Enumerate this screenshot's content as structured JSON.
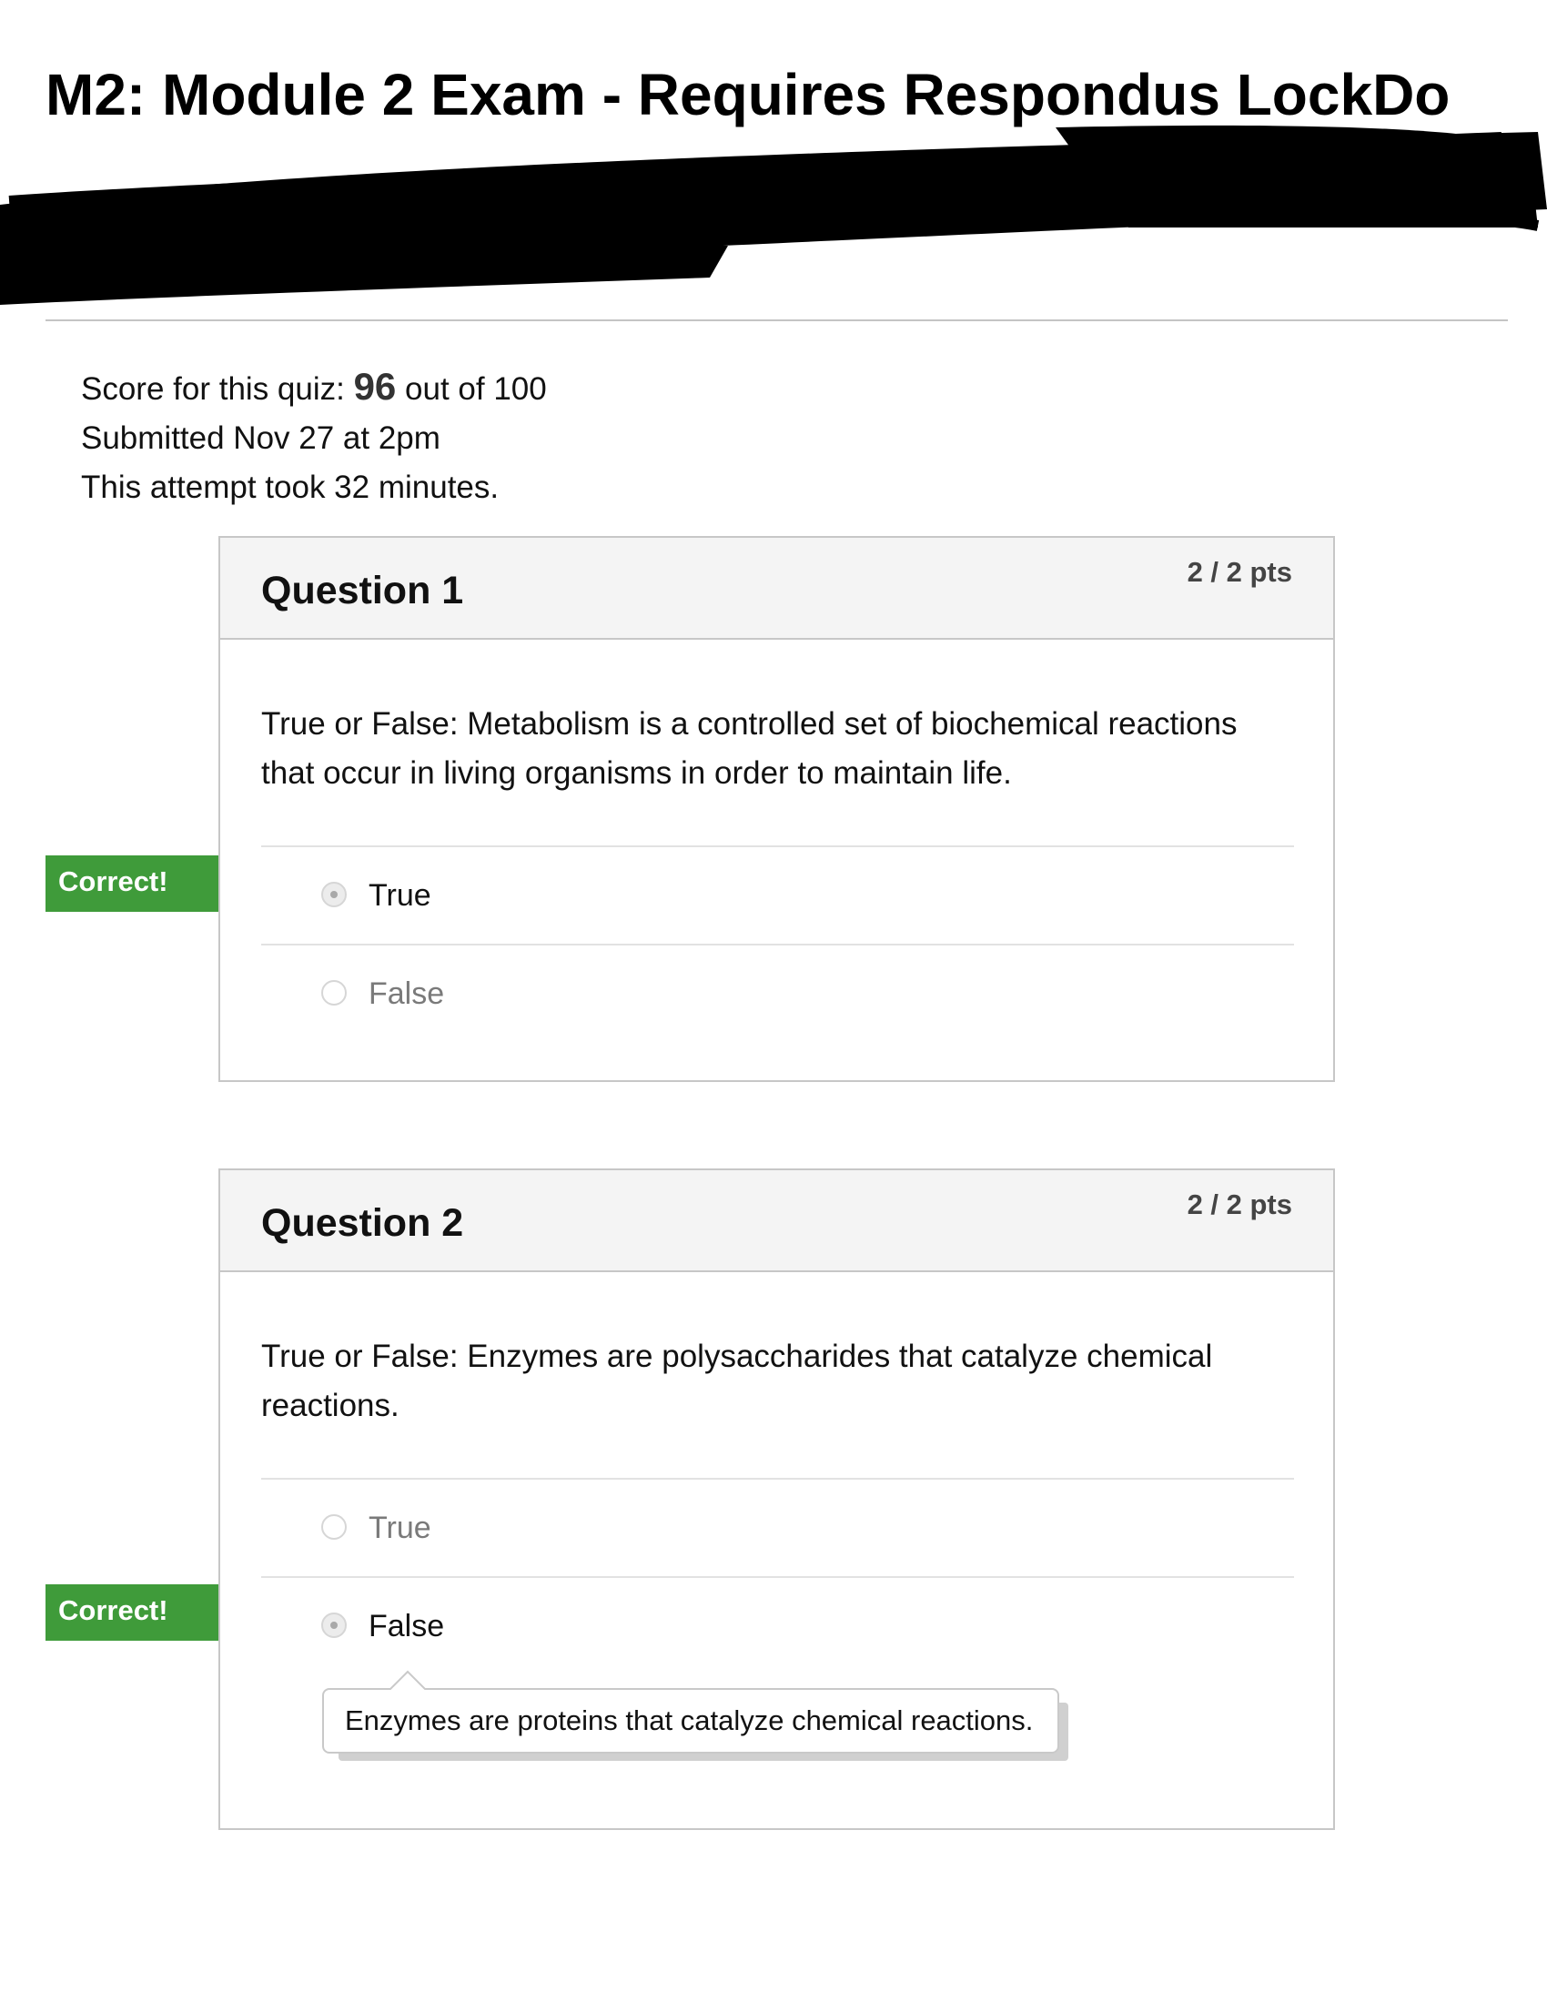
{
  "page": {
    "title": "M2: Module 2 Exam - Requires Respondus LockDo"
  },
  "summary": {
    "score_prefix": "Score for this quiz: ",
    "score_value": "96",
    "score_suffix": " out of 100",
    "submitted": "Submitted Nov 27 at 2pm",
    "duration": "This attempt took 32 minutes."
  },
  "questions": [
    {
      "title": "Question 1",
      "points": "2 / 2 pts",
      "text": "True or False: Metabolism is a controlled set of biochemical reactions that occur in living organisms in order to maintain life.",
      "answers": [
        {
          "label": "True",
          "selected": true
        },
        {
          "label": "False",
          "selected": false
        }
      ],
      "correct_label": "Correct!"
    },
    {
      "title": "Question 2",
      "points": "2 / 2 pts",
      "text": "True or False: Enzymes are polysaccharides that catalyze chemical reactions.",
      "answers": [
        {
          "label": "True",
          "selected": false
        },
        {
          "label": "False",
          "selected": true
        }
      ],
      "correct_label": "Correct!",
      "comment": "Enzymes are proteins that catalyze chemical reactions."
    }
  ],
  "colors": {
    "correct_flag": "#3f9b3a",
    "header_bg": "#f4f4f4",
    "border": "#c7c7c7"
  }
}
